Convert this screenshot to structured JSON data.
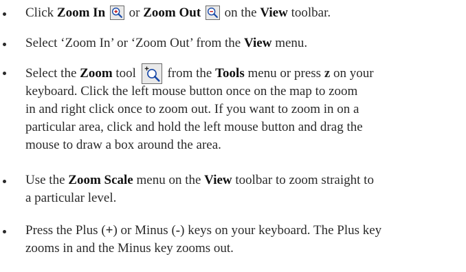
{
  "bullets": [
    {
      "parts": [
        "Click ",
        "Zoom In",
        " or ",
        "Zoom Out",
        " on the ",
        "View",
        " toolbar."
      ],
      "icons": [
        "zoom-in-icon",
        "zoom-out-icon"
      ]
    },
    {
      "parts": [
        "Select ‘Zoom In’ or ‘Zoom Out’ from the ",
        "View",
        " menu."
      ]
    },
    {
      "parts": [
        "Select the ",
        "Zoom",
        " tool",
        " from the ",
        "Tools",
        " menu or press ",
        "z",
        " on your"
      ],
      "lines": [
        "keyboard. Click the left mouse button once on the map to zoom",
        "in and right click once to zoom out. If you want to zoom in on a",
        "particular area, click and hold the left mouse button and drag the",
        "mouse to draw a box around the area."
      ],
      "icons": [
        "zoom-tool-icon"
      ]
    },
    {
      "parts": [
        "Use the ",
        "Zoom Scale",
        " menu on the ",
        "View",
        " toolbar to zoom straight to"
      ],
      "lines": [
        "a particular level."
      ]
    },
    {
      "parts": [
        "Press the Plus (",
        "+",
        ") or Minus (",
        "-",
        ") keys on your keyboard. The Plus key"
      ],
      "lines": [
        "zooms in and the Minus key zooms out."
      ]
    }
  ]
}
